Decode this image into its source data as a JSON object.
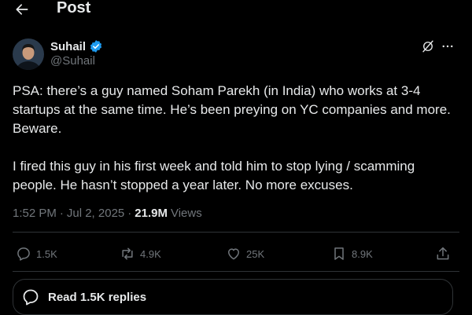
{
  "header": {
    "title": "Post",
    "back_icon": "arrow-left-icon"
  },
  "author": {
    "name": "Suhail",
    "handle": "@Suhail",
    "verified": true,
    "verified_color": "#1d9bf0",
    "avatar_icon": "avatar-portrait"
  },
  "post": {
    "paragraphs": [
      "PSA: there’s a guy named Soham Parekh (in India) who works at 3-4 startups at the same time. He’s been preying on YC companies and more. Beware.",
      "I fired this guy in his first week and told him to stop lying / scamming people. He hasn’t stopped a year later. No more excuses."
    ],
    "time": "1:52 PM",
    "date": "Jul 2, 2025",
    "separator": "·",
    "views_count": "21.9M",
    "views_label": "Views"
  },
  "actions": {
    "replies": "1.5K",
    "reposts": "4.9K",
    "likes": "25K",
    "bookmarks": "8.9K"
  },
  "replies_button": {
    "label": "Read 1.5K replies"
  },
  "colors": {
    "background": "#000000",
    "text_primary": "#e7e9ea",
    "text_secondary": "#71767b",
    "border": "#2f3336",
    "accent": "#1d9bf0"
  }
}
